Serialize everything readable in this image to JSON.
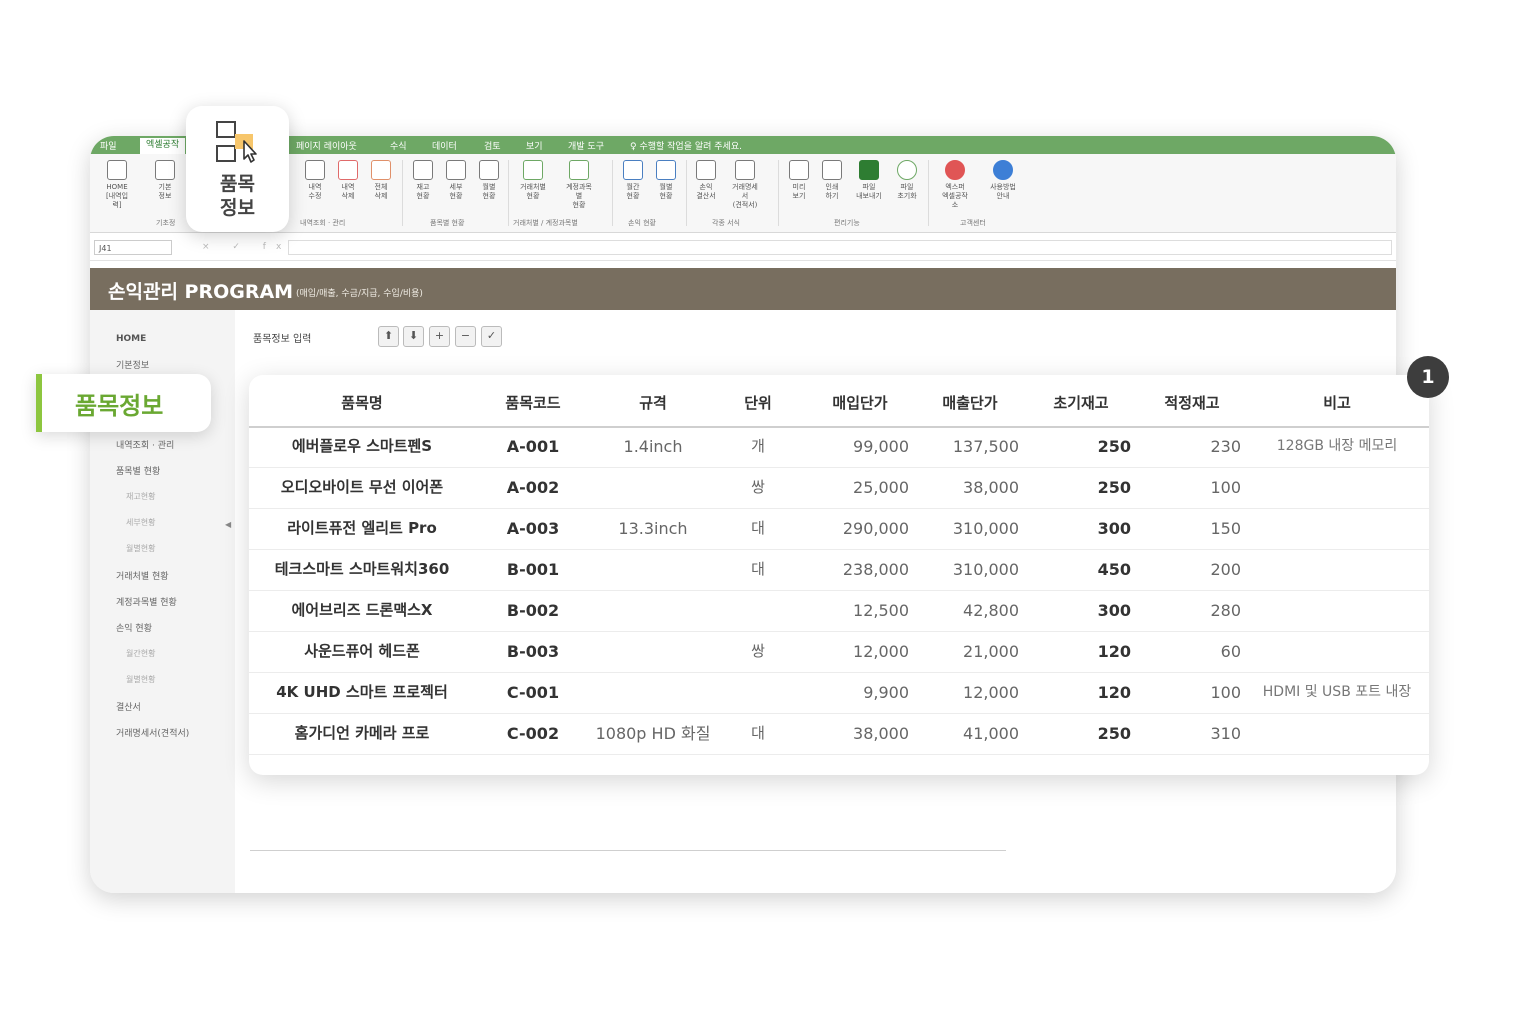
{
  "ribbon": {
    "tabs": [
      "파일",
      "엑셀공작",
      "페이지 레이아웃",
      "수식",
      "데이터",
      "검토",
      "보기",
      "개발 도구",
      "♀ 수행할 작업을 알려 주세요."
    ],
    "buttons": [
      {
        "label": "HOME\n[내역입력]"
      },
      {
        "label": "기본\n정보"
      },
      {
        "label": "내역\n수정"
      },
      {
        "label": "내역\n삭제"
      },
      {
        "label": "전체\n삭제"
      },
      {
        "label": "재고\n현황"
      },
      {
        "label": "세부\n현황"
      },
      {
        "label": "월별\n현황"
      },
      {
        "label": "거래처별\n현황"
      },
      {
        "label": "계정과목별\n현황"
      },
      {
        "label": "월간\n현황"
      },
      {
        "label": "월별\n현황"
      },
      {
        "label": "손익\n결산서"
      },
      {
        "label": "거래명세서\n(견적서)"
      },
      {
        "label": "미리\n보기"
      },
      {
        "label": "인쇄\n하기"
      },
      {
        "label": "파일\n내보내기"
      },
      {
        "label": "파일\n초기화"
      },
      {
        "label": "엑스퍼\n엑셀공작소"
      },
      {
        "label": "사용방법\n안내"
      }
    ],
    "groups": [
      "기초정",
      "내역조회 · 관리",
      "품목별 현황",
      "거래처별 / 계정과목별",
      "손익 현황",
      "각종 서식",
      "편리기능",
      "고객센터"
    ]
  },
  "formula": {
    "cell_ref": "J41",
    "icons": "× ✓ fx"
  },
  "title": {
    "main": "손익관리 PROGRAM",
    "sub": "(매입/매출, 수금/지급, 수입/비용)"
  },
  "sidebar": {
    "items": [
      {
        "label": "HOME",
        "kind": "home"
      },
      {
        "label": "기본정보",
        "kind": "main"
      },
      {
        "label": "내역조회 · 관리",
        "kind": "main"
      },
      {
        "label": "품목별 현황",
        "kind": "main"
      },
      {
        "label": "재고현황",
        "kind": "sub"
      },
      {
        "label": "세부현황",
        "kind": "sub"
      },
      {
        "label": "월별현황",
        "kind": "sub"
      },
      {
        "label": "거래처별 현황",
        "kind": "main"
      },
      {
        "label": "계정과목별 현황",
        "kind": "main"
      },
      {
        "label": "손익 현황",
        "kind": "main"
      },
      {
        "label": "월간현황",
        "kind": "sub"
      },
      {
        "label": "월별현황",
        "kind": "sub"
      },
      {
        "label": "결산서",
        "kind": "main"
      },
      {
        "label": "거래명세서(견적서)",
        "kind": "main"
      }
    ],
    "collapse_arrow": "◀"
  },
  "content": {
    "input_label": "품목정보 입력",
    "toolbar": [
      "⬆",
      "⬇",
      "+",
      "−",
      "✓"
    ]
  },
  "table": {
    "headers": [
      "품목명",
      "품목코드",
      "규격",
      "단위",
      "매입단가",
      "매출단가",
      "초기재고",
      "적정재고",
      "비고"
    ],
    "rows": [
      [
        "에버플로우 스마트펜S",
        "A-001",
        "1.4inch",
        "개",
        "99,000",
        "137,500",
        "250",
        "230",
        "128GB 내장 메모리"
      ],
      [
        "오디오바이트 무선 이어폰",
        "A-002",
        "",
        "쌍",
        "25,000",
        "38,000",
        "250",
        "100",
        ""
      ],
      [
        "라이트퓨전 엘리트 Pro",
        "A-003",
        "13.3inch",
        "대",
        "290,000",
        "310,000",
        "300",
        "150",
        ""
      ],
      [
        "테크스마트 스마트워치360",
        "B-001",
        "",
        "대",
        "238,000",
        "310,000",
        "450",
        "200",
        ""
      ],
      [
        "에어브리즈 드론맥스X",
        "B-002",
        "",
        "",
        "12,500",
        "42,800",
        "300",
        "280",
        ""
      ],
      [
        "사운드퓨어 헤드폰",
        "B-003",
        "",
        "쌍",
        "12,000",
        "21,000",
        "120",
        "60",
        ""
      ],
      [
        "4K UHD 스마트 프로젝터",
        "C-001",
        "",
        "",
        "9,900",
        "12,000",
        "120",
        "100",
        "HDMI 및 USB 포트 내장"
      ],
      [
        "홈가디언 카메라 프로",
        "C-002",
        "1080p HD 화질",
        "대",
        "38,000",
        "41,000",
        "250",
        "310",
        ""
      ]
    ]
  },
  "badge": "1",
  "callout": {
    "label": "품목정보"
  },
  "tooltip": {
    "label": "품목\n정보"
  },
  "colors": {
    "ribbon_green": "#6ea865",
    "title_bar": "#786e5f",
    "accent_green": "#8dc63f"
  }
}
